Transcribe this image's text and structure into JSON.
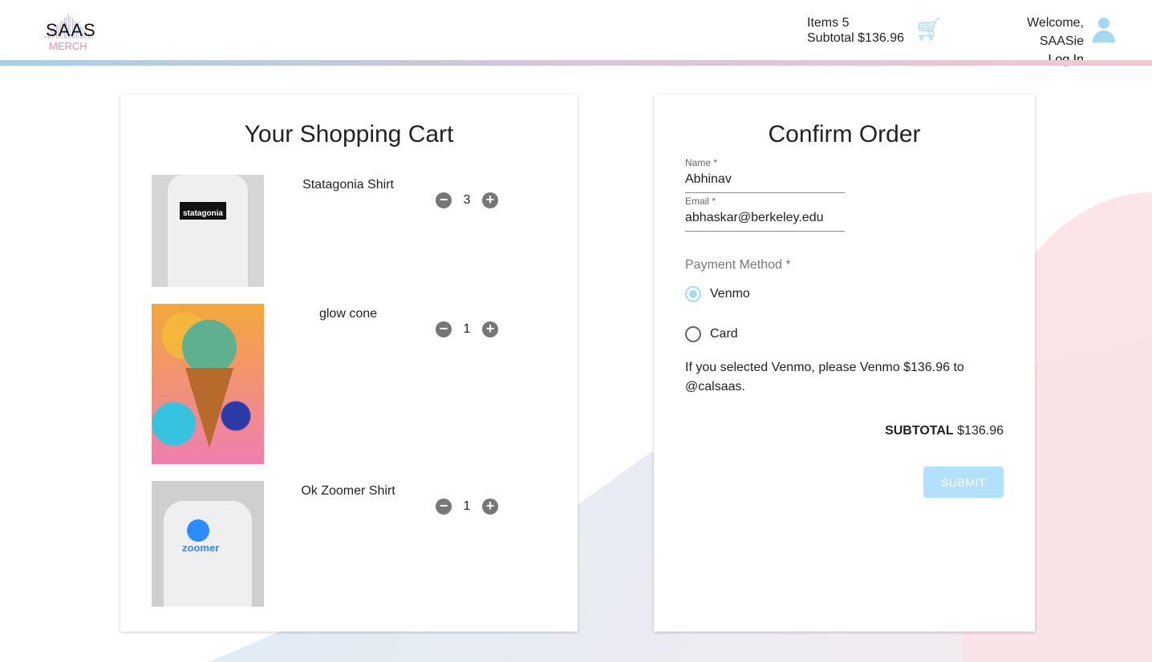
{
  "brand": {
    "name": "SAAS",
    "sub": "MERCH"
  },
  "header": {
    "items_label": "Items 5",
    "subtotal_label": "Subtotal $136.96",
    "welcome": "Welcome, SAASie",
    "login": "Log In"
  },
  "cart": {
    "title": "Your Shopping Cart",
    "items": [
      {
        "name": "Statagonia Shirt",
        "qty": "3",
        "print": "statagonia"
      },
      {
        "name": "glow cone",
        "qty": "1"
      },
      {
        "name": "Ok Zoomer Shirt",
        "qty": "1",
        "print": "zoomer"
      }
    ]
  },
  "order": {
    "title": "Confirm Order",
    "name_label": "Name *",
    "name_value": "Abhinav",
    "email_label": "Email *",
    "email_value": "abhaskar@berkeley.edu",
    "payment_label": "Payment Method *",
    "options": [
      "Venmo",
      "Card"
    ],
    "selected": "Venmo",
    "note": "If you selected Venmo, please Venmo $136.96 to @calsaas.",
    "subtotal_label": "SUBTOTAL",
    "subtotal_value": "$136.96",
    "submit": "SUBMIT"
  }
}
